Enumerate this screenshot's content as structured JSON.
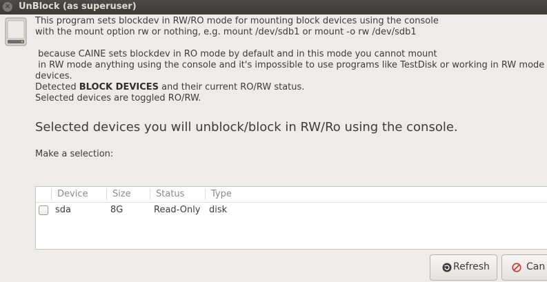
{
  "window": {
    "title": "UnBlock (as superuser)"
  },
  "description": {
    "line1": "This program sets blockdev in RW/RO mode for mounting block devices using the console",
    "line2": "with the mount option rw or nothing, e.g. mount /dev/sdb1 or mount -o rw /dev/sdb1",
    "line3": " because CAINE sets blockdev in RO mode by default and in this mode you cannot mount",
    "line4": " in RW mode anything using the console and it's impossible to use programs like TestDisk or working in RW mode",
    "line5": "devices.",
    "line6_prefix": "Detected ",
    "line6_bold": "BLOCK DEVICES",
    "line6_suffix": " and their current RO/RW status.",
    "line7": "Selected devices are toggled RO/RW."
  },
  "heading": "Selected devices you will unblock/block in RW/Ro using the console.",
  "prompt": "Make a selection:",
  "table": {
    "columns": [
      "Device",
      "Size",
      "Status",
      "Type"
    ],
    "rows": [
      {
        "checked": false,
        "device": "sda",
        "size": "8G",
        "status": "Read-Only",
        "type": "disk"
      }
    ]
  },
  "buttons": {
    "refresh": {
      "label": "Refresh",
      "icon": "refresh-icon"
    },
    "cancel": {
      "label": "Can",
      "icon": "cancel-icon"
    }
  },
  "colors": {
    "titlebar": "#3c3b37",
    "background": "#edeceb",
    "cancel_icon": "#d0342c"
  }
}
